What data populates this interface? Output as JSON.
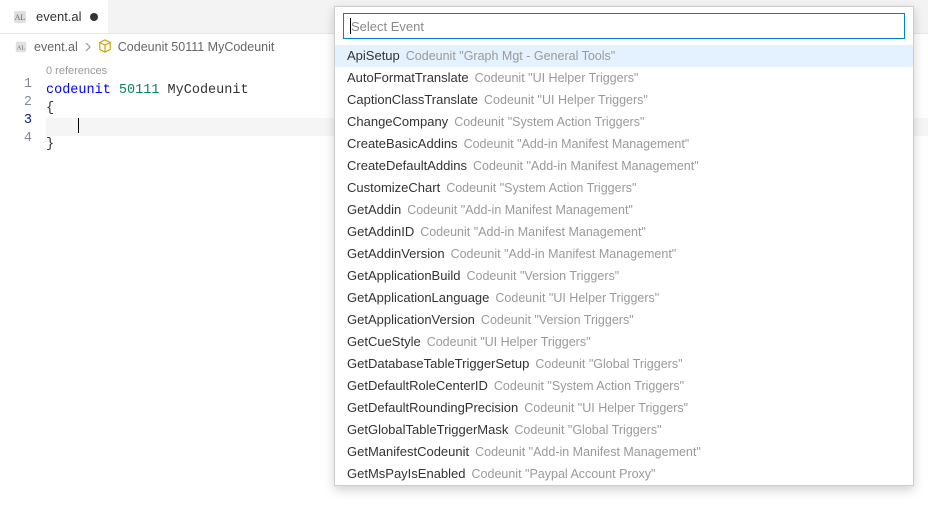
{
  "tab": {
    "filename": "event.al"
  },
  "breadcrumb": {
    "file": "event.al",
    "symbol": "Codeunit 50111 MyCodeunit"
  },
  "editor": {
    "references_label": "0 references",
    "lines": {
      "l1_kw": "codeunit",
      "l1_num": "50111",
      "l1_id": "MyCodeunit",
      "l2": "{",
      "l4": "}"
    },
    "line_numbers": [
      "1",
      "2",
      "3",
      "4"
    ]
  },
  "picker": {
    "placeholder": "Select Event",
    "items": [
      {
        "event": "ApiSetup",
        "source": "Codeunit \"Graph Mgt - General Tools\""
      },
      {
        "event": "AutoFormatTranslate",
        "source": "Codeunit \"UI Helper Triggers\""
      },
      {
        "event": "CaptionClassTranslate",
        "source": "Codeunit \"UI Helper Triggers\""
      },
      {
        "event": "ChangeCompany",
        "source": "Codeunit \"System Action Triggers\""
      },
      {
        "event": "CreateBasicAddins",
        "source": "Codeunit \"Add-in Manifest Management\""
      },
      {
        "event": "CreateDefaultAddins",
        "source": "Codeunit \"Add-in Manifest Management\""
      },
      {
        "event": "CustomizeChart",
        "source": "Codeunit \"System Action Triggers\""
      },
      {
        "event": "GetAddin",
        "source": "Codeunit \"Add-in Manifest Management\""
      },
      {
        "event": "GetAddinID",
        "source": "Codeunit \"Add-in Manifest Management\""
      },
      {
        "event": "GetAddinVersion",
        "source": "Codeunit \"Add-in Manifest Management\""
      },
      {
        "event": "GetApplicationBuild",
        "source": "Codeunit \"Version Triggers\""
      },
      {
        "event": "GetApplicationLanguage",
        "source": "Codeunit \"UI Helper Triggers\""
      },
      {
        "event": "GetApplicationVersion",
        "source": "Codeunit \"Version Triggers\""
      },
      {
        "event": "GetCueStyle",
        "source": "Codeunit \"UI Helper Triggers\""
      },
      {
        "event": "GetDatabaseTableTriggerSetup",
        "source": "Codeunit \"Global Triggers\""
      },
      {
        "event": "GetDefaultRoleCenterID",
        "source": "Codeunit \"System Action Triggers\""
      },
      {
        "event": "GetDefaultRoundingPrecision",
        "source": "Codeunit \"UI Helper Triggers\""
      },
      {
        "event": "GetGlobalTableTriggerMask",
        "source": "Codeunit \"Global Triggers\""
      },
      {
        "event": "GetManifestCodeunit",
        "source": "Codeunit \"Add-in Manifest Management\""
      },
      {
        "event": "GetMsPayIsEnabled",
        "source": "Codeunit \"Paypal Account Proxy\""
      }
    ]
  }
}
